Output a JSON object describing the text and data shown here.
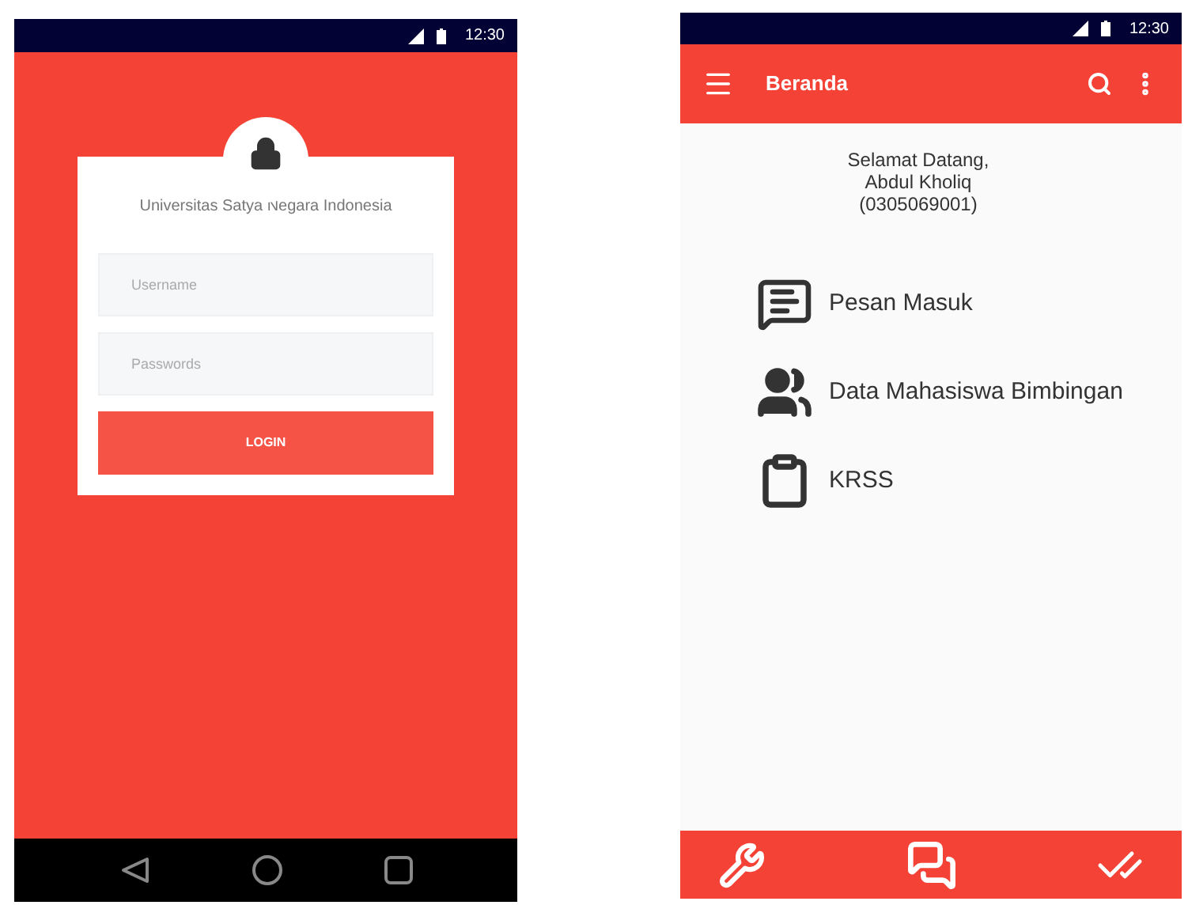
{
  "login_screen": {
    "status_bar": {
      "time": "12:30"
    },
    "title": "Universitas Satya Negara Indonesia",
    "fields": [
      {
        "placeholder": "Username"
      },
      {
        "placeholder": "Passwords"
      }
    ],
    "button": "LOGIN"
  },
  "home_screen": {
    "status_bar": {
      "time": "12:30"
    },
    "app_bar": {
      "title": "Beranda"
    },
    "welcome": [
      "Selamat Datang,",
      "Abdul Kholiq",
      "(0305069001)"
    ],
    "menu": [
      {
        "label": "Pesan Masuk",
        "kind": "messages"
      },
      {
        "label": "Data Mahasiswa Bimbingan",
        "kind": "people"
      },
      {
        "label": "KRSS",
        "kind": "clipboard"
      }
    ]
  }
}
